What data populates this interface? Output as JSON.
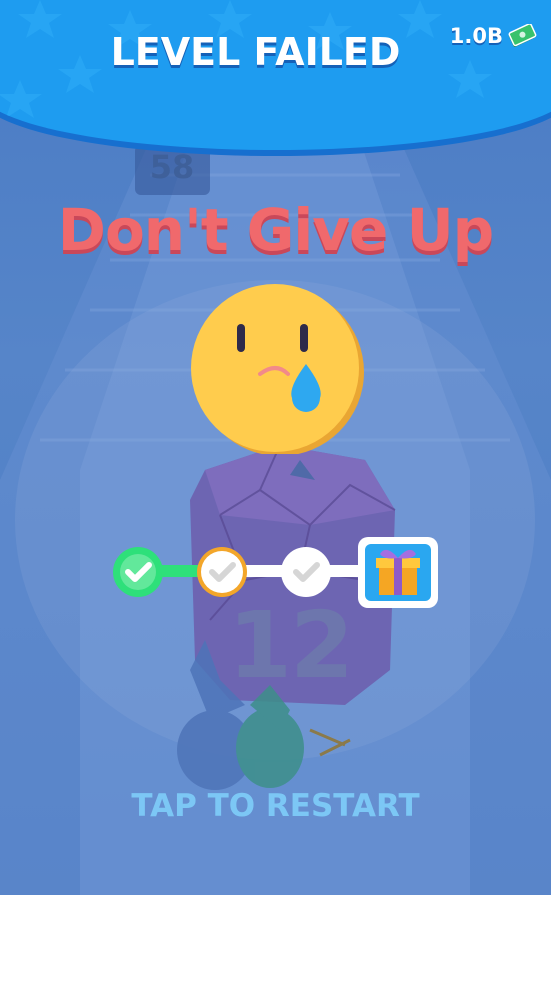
{
  "header": {
    "title": "LEVEL FAILED",
    "currency_value": "1.0B",
    "currency_icon": "cash-icon",
    "color": "#1e9cf0"
  },
  "background": {
    "counter_label": "58",
    "obstacle_number": "12"
  },
  "main": {
    "headline": "Don't Give Up",
    "headline_color": "#f0696c",
    "face_icon": "crying-face-icon",
    "restart_label": "TAP TO RESTART"
  },
  "progress": {
    "steps": [
      {
        "state": "completed",
        "icon": "check-icon",
        "color": "#2ee07a"
      },
      {
        "state": "current",
        "icon": "check-icon",
        "color": "#f3a62a"
      },
      {
        "state": "upcoming",
        "icon": "check-icon",
        "color": "#ffffff"
      },
      {
        "state": "reward",
        "icon": "gift-box-icon",
        "color": "#2aa7f0"
      }
    ],
    "completed_fraction": 0.33
  }
}
